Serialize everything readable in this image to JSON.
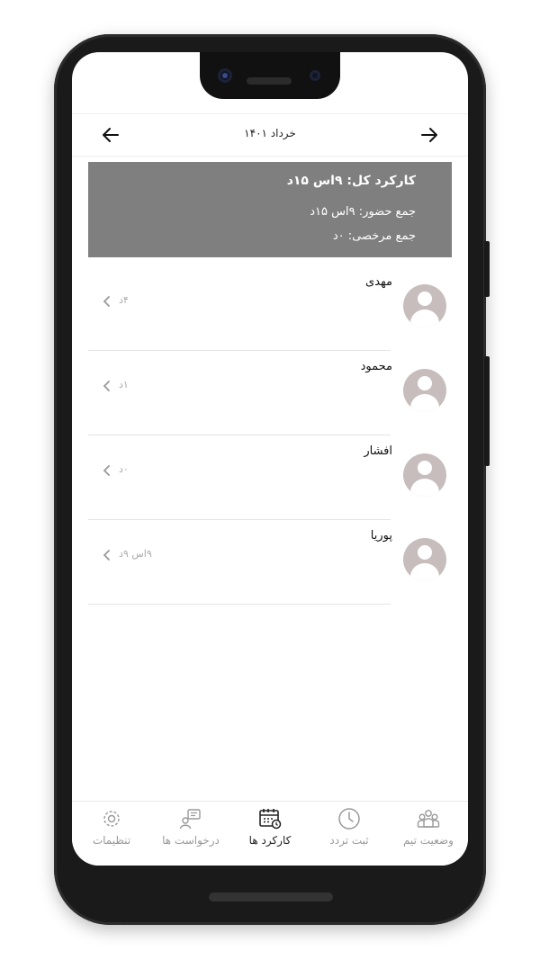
{
  "header": {
    "month_label": "خرداد ۱۴۰۱"
  },
  "summary": {
    "total_label": "کارکرد کل: ۹اس ۱۵د",
    "presence_label": "جمع حضور: ۹اس ۱۵د",
    "leave_label": "جمع مرخصی: ۰د"
  },
  "members": [
    {
      "name": "مهدی",
      "hours": "۴د"
    },
    {
      "name": "محمود",
      "hours": "۱د"
    },
    {
      "name": "افشار",
      "hours": "۰د"
    },
    {
      "name": "پوریا",
      "hours": "۹اس ۹د"
    }
  ],
  "tabs": [
    {
      "label": "وضعیت تیم",
      "icon": "team-icon"
    },
    {
      "label": "ثبت تردد",
      "icon": "clock-icon"
    },
    {
      "label": "کارکرد ها",
      "icon": "calendar-icon",
      "active": true
    },
    {
      "label": "درخواست ها",
      "icon": "request-icon"
    },
    {
      "label": "تنظیمات",
      "icon": "settings-icon"
    }
  ],
  "colors": {
    "summary_bg": "#7f7f7f",
    "avatar": "#c7bdbd",
    "inactive": "#999999",
    "active": "#222222"
  }
}
